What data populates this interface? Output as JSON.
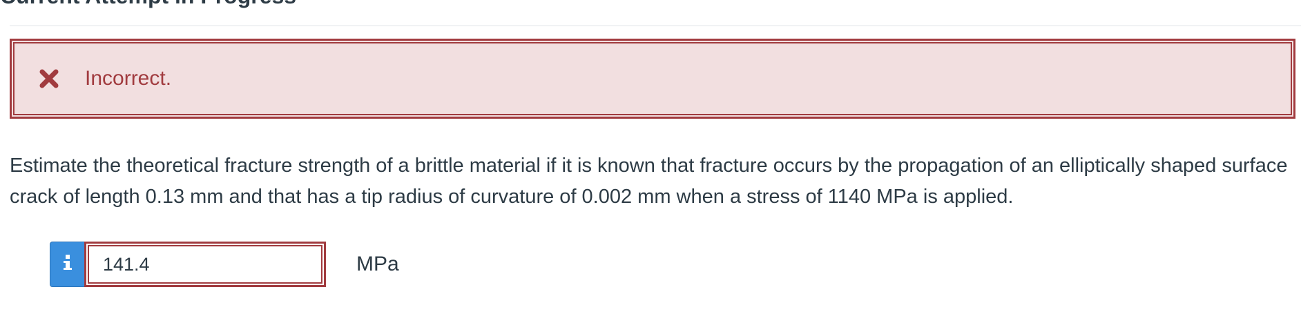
{
  "section": {
    "heading": "Current Attempt in Progress"
  },
  "feedback": {
    "icon": "x-icon",
    "status_text": "Incorrect.",
    "color": "#a13b3f",
    "background": "#f2dfe0"
  },
  "question": {
    "text": "Estimate the theoretical fracture strength of a brittle material if it is known that fracture occurs by the propagation of an elliptically shaped surface crack of length 0.13 mm and that has a tip radius of curvature of 0.002 mm when a stress of 1140 MPa is applied."
  },
  "answer": {
    "info_icon": "info-icon",
    "info_button_color": "#3a8fde",
    "value": "141.4",
    "unit": "MPa"
  }
}
